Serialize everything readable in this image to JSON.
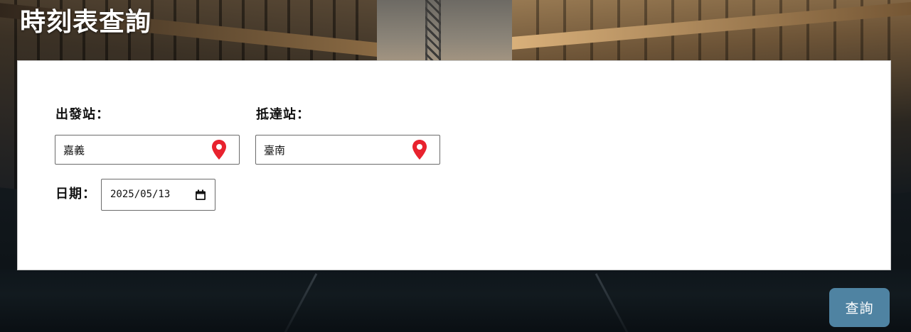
{
  "page": {
    "title": "時刻表查詢"
  },
  "form": {
    "departure": {
      "label": "出發站：",
      "value": "嘉義",
      "icon": "map-pin-icon"
    },
    "arrival": {
      "label": "抵達站：",
      "value": "臺南",
      "icon": "map-pin-icon"
    },
    "date": {
      "label": "日期：",
      "value": "2025/05/13",
      "icon": "calendar-icon"
    }
  },
  "actions": {
    "query_label": "查詢"
  },
  "colors": {
    "pin": "#e8222e",
    "button": "#4f83a2",
    "panel": "#ffffff",
    "title": "#ffffff"
  }
}
